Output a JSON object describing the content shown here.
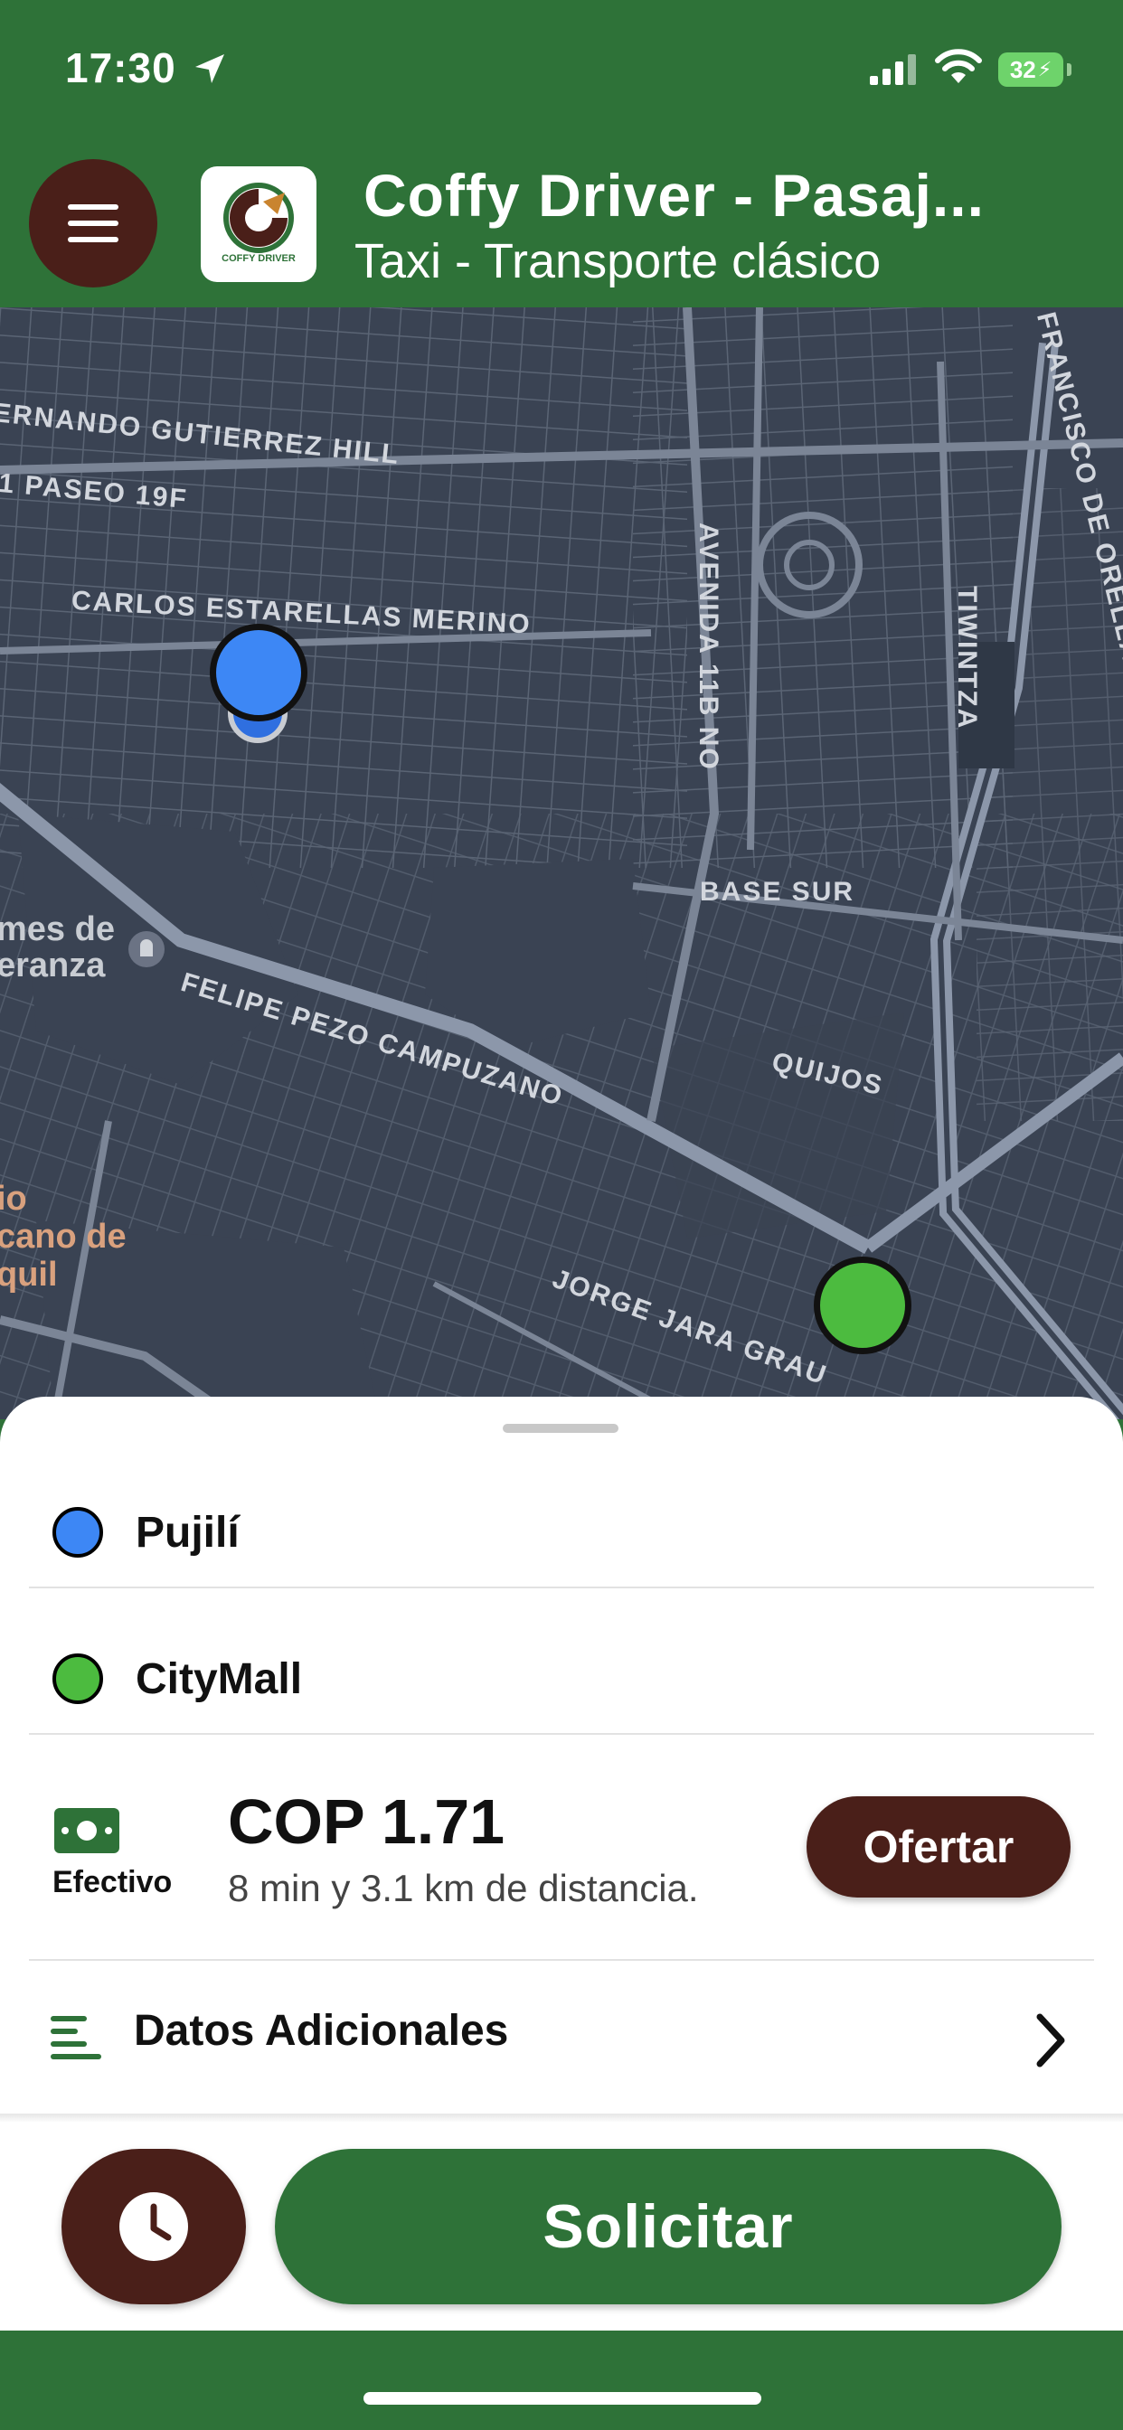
{
  "status_bar": {
    "time": "17:30",
    "battery": "32",
    "icons": [
      "location-arrow-icon",
      "cellular-signal-icon",
      "wifi-icon",
      "battery-charging-icon"
    ]
  },
  "header": {
    "title": "Coffy Driver - Pasaj...",
    "subtitle": "Taxi - Transporte clásico",
    "logo_text": "COFFY DRIVER",
    "menu_icon": "hamburger-menu-icon"
  },
  "map": {
    "street_labels": [
      "ERNANDO GUTIERREZ HILL",
      "1 PASEO 19F",
      "CARLOS ESTARELLAS MERINO",
      "AVENIDA 11B NO",
      "TIWINTZA",
      "FRANCISCO DE ORELLANA",
      "BASE SUR",
      "FELIPE PEZO CAMPUZANO",
      "QUIJOS",
      "JORGE JARA GRAU"
    ],
    "poi_labels": [
      "mes de",
      "eranza",
      "io",
      "cano de",
      "quil"
    ],
    "origin_marker_color": "#3d87f5",
    "destination_marker_color": "#4cbb3f"
  },
  "trip": {
    "origin": "Pujilí",
    "destination": "CityMall",
    "payment_label": "Efectivo",
    "price": "COP 1.71",
    "distance_text": "8 min y 3.1 km de distancia.",
    "offer_button": "Ofertar",
    "additional_data": "Datos Adicionales",
    "request_button": "Solicitar"
  },
  "colors": {
    "brand_green": "#2e7238",
    "brand_brown": "#4a1f19",
    "origin_blue": "#3d87f5",
    "destination_green": "#4cbb3f"
  }
}
